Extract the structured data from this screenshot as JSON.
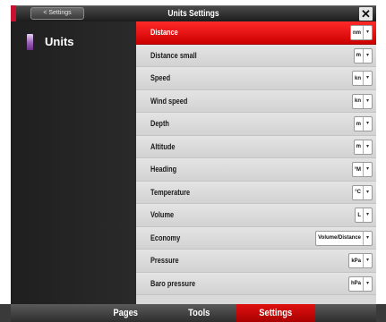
{
  "window": {
    "title": "Units Settings",
    "back_label": "< Settings",
    "close_glyph": "✕"
  },
  "sidebar": {
    "items": [
      {
        "label": "Units",
        "icon": "units-icon"
      }
    ]
  },
  "settings": {
    "rows": [
      {
        "label": "Distance",
        "value": "nm",
        "selected": true
      },
      {
        "label": "Distance small",
        "value": "m"
      },
      {
        "label": "Speed",
        "value": "kn"
      },
      {
        "label": "Wind speed",
        "value": "kn"
      },
      {
        "label": "Depth",
        "value": "m"
      },
      {
        "label": "Altitude",
        "value": "m"
      },
      {
        "label": "Heading",
        "value": "°M"
      },
      {
        "label": "Temperature",
        "value": "°C"
      },
      {
        "label": "Volume",
        "value": "L"
      },
      {
        "label": "Economy",
        "value": "Volume/Distance"
      },
      {
        "label": "Pressure",
        "value": "kPa"
      },
      {
        "label": "Baro pressure",
        "value": "hPa"
      }
    ]
  },
  "bottom_tabs": {
    "pages": "Pages",
    "tools": "Tools",
    "settings": "Settings"
  },
  "colors": {
    "accent": "#cc0000",
    "panel": "#222222",
    "row": "#dadada"
  }
}
